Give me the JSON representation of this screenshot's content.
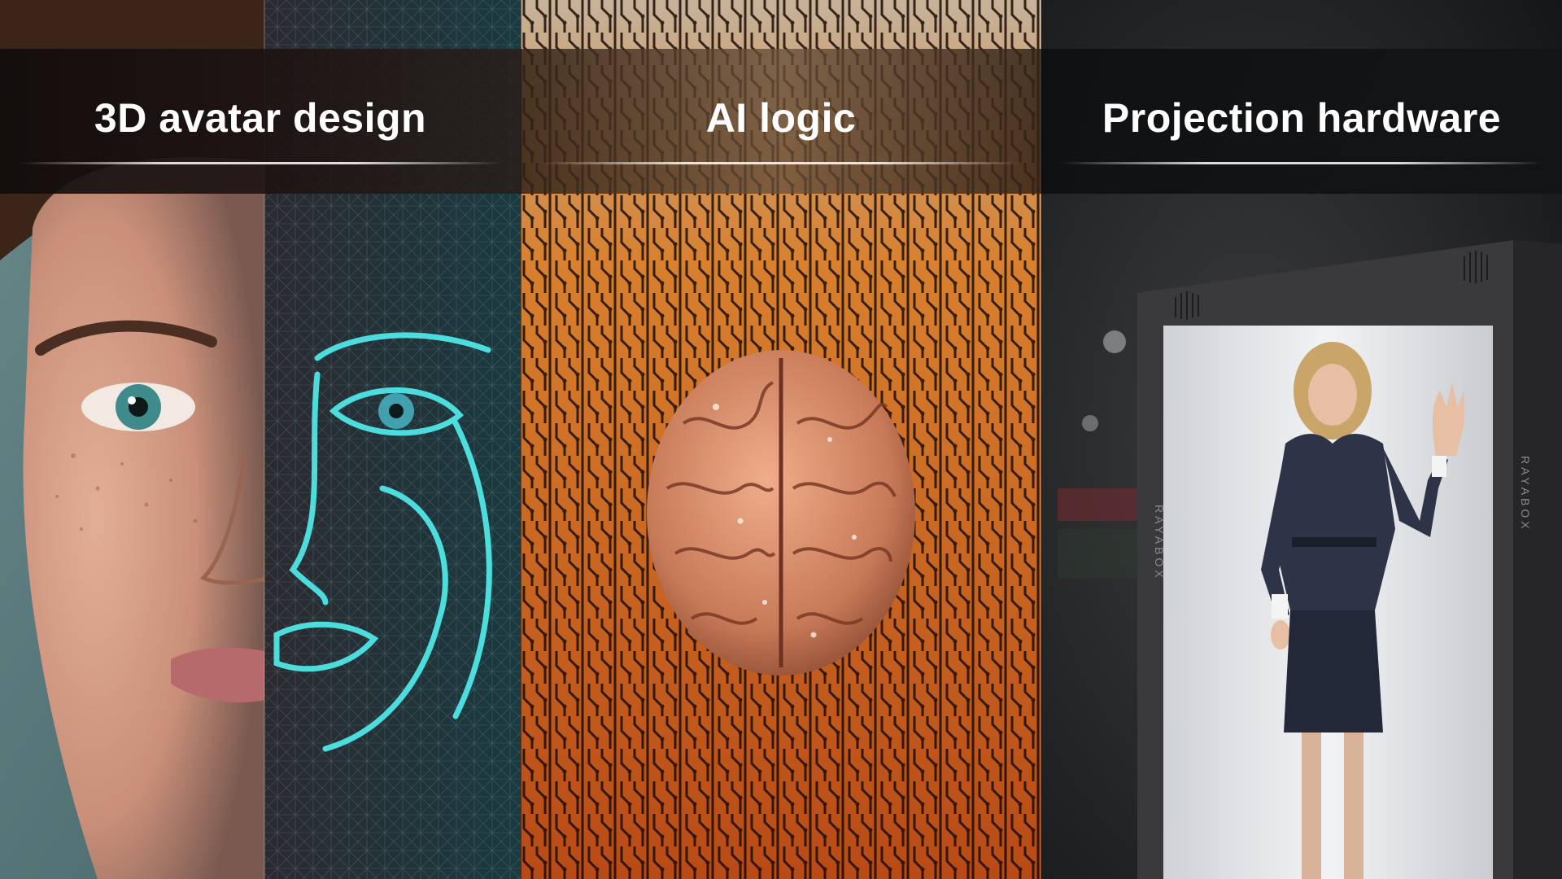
{
  "panels": [
    {
      "title": "3D avatar design",
      "illustration": "face-wireframe-image"
    },
    {
      "title": "AI logic",
      "illustration": "brain-circuit-image"
    },
    {
      "title": "Projection hardware",
      "illustration": "hologram-box-image"
    }
  ],
  "colors": {
    "wireframe": "#4fe6e6",
    "circuit": "#e07a2a",
    "brain": "#d98a6a",
    "hardware": "#3a3a3c"
  },
  "brand_mark": "RAYABOX"
}
